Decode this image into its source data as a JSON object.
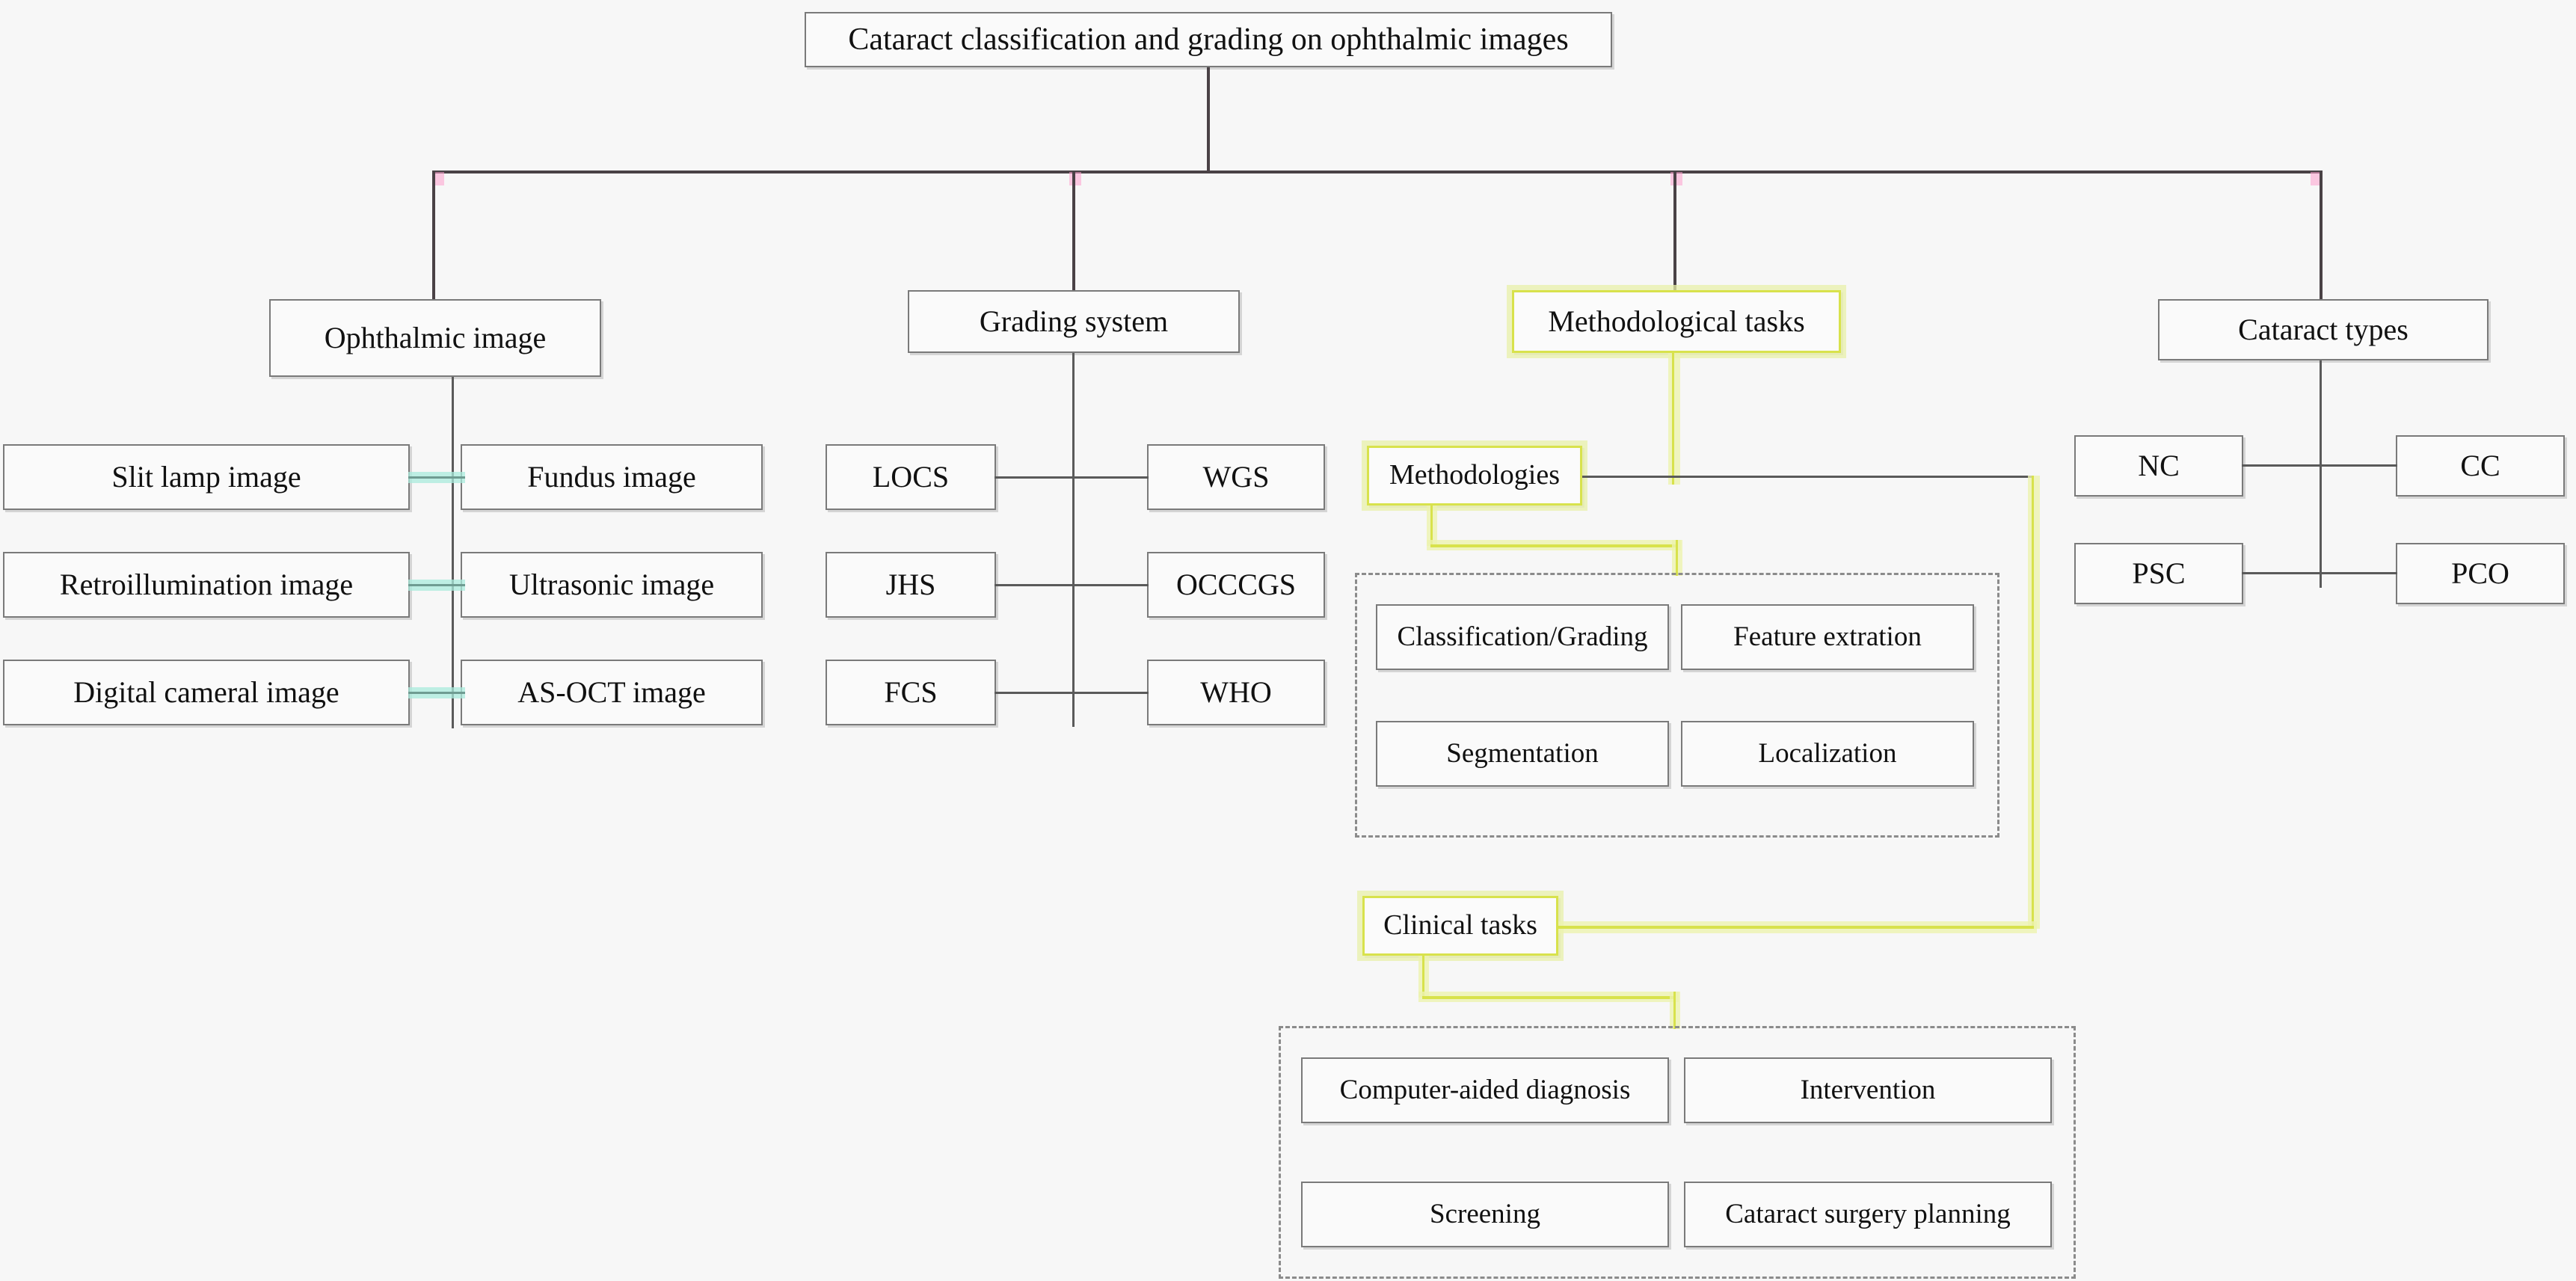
{
  "diagram": {
    "title": "Cataract classification and grading on ophthalmic images",
    "colors": {
      "box_border": "#7a7a7a",
      "highlight_border": "#d8e24c",
      "highlight_glow": "#ecf2af",
      "bus_line": "#4a4246",
      "bus_accent_pink": "#ffa0cd",
      "teal_connector": "#6f9c92",
      "teal_glow": "#aaebdc",
      "dashed_border": "#8b8b8b",
      "background": "#f7f7f7",
      "text": "#111111"
    },
    "branches": [
      {
        "id": "ophthalmic-image",
        "label": "Ophthalmic image",
        "left_column": [
          "Slit lamp image",
          "Retroillumination image",
          "Digital cameral image"
        ],
        "right_column": [
          "Fundus image",
          "Ultrasonic image",
          "AS-OCT image"
        ]
      },
      {
        "id": "grading-system",
        "label": "Grading system",
        "left_column": [
          "LOCS",
          "JHS",
          "FCS"
        ],
        "right_column": [
          "WGS",
          "OCCCGS",
          "WHO"
        ]
      },
      {
        "id": "methodological-tasks",
        "label": "Methodological tasks",
        "highlighted": true,
        "subgroups": [
          {
            "id": "methodologies",
            "label": "Methodologies",
            "highlighted": true,
            "items": [
              "Classification/Grading",
              "Feature extration",
              "Segmentation",
              "Localization"
            ]
          },
          {
            "id": "clinical-tasks",
            "label": "Clinical tasks",
            "highlighted": true,
            "items": [
              "Computer-aided diagnosis",
              "Intervention",
              "Screening",
              "Cataract surgery planning"
            ]
          }
        ]
      },
      {
        "id": "cataract-types",
        "label": "Cataract types",
        "left_column": [
          "NC",
          "PSC"
        ],
        "right_column": [
          "CC",
          "PCO"
        ]
      }
    ]
  }
}
